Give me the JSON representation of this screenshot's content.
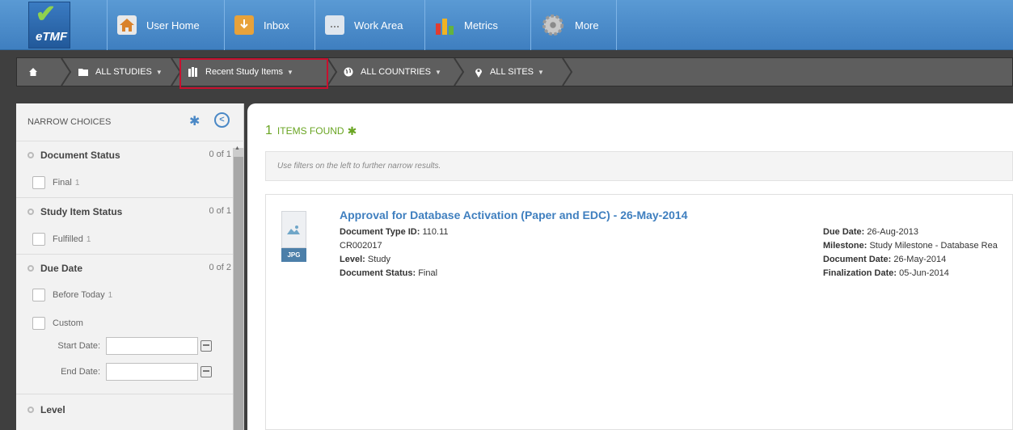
{
  "app": {
    "logo_text": "eTMF"
  },
  "topnav": {
    "items": [
      {
        "label": "User Home",
        "icon": "home-icon"
      },
      {
        "label": "Inbox",
        "icon": "inbox-icon"
      },
      {
        "label": "Work Area",
        "icon": "document-icon"
      },
      {
        "label": "Metrics",
        "icon": "bar-chart-icon"
      },
      {
        "label": "More",
        "icon": "gear-icon"
      }
    ]
  },
  "breadcrumb": {
    "items": [
      {
        "label": "",
        "icon": "home-icon"
      },
      {
        "label": "ALL STUDIES",
        "icon": "folder-icon"
      },
      {
        "label": "Recent Study Items",
        "icon": "books-icon"
      },
      {
        "label": "ALL COUNTRIES",
        "icon": "globe-icon"
      },
      {
        "label": "ALL SITES",
        "icon": "map-pin-icon"
      }
    ]
  },
  "sidebar": {
    "title": "NARROW CHOICES",
    "sections": [
      {
        "title": "Document Status",
        "count": "0 of 1",
        "options": [
          {
            "label": "Final",
            "count": "1"
          }
        ]
      },
      {
        "title": "Study Item Status",
        "count": "0 of 1",
        "options": [
          {
            "label": "Fulfilled",
            "count": "1"
          }
        ]
      },
      {
        "title": "Due Date",
        "count": "0 of 2",
        "options": [
          {
            "label": "Before Today",
            "count": "1"
          },
          {
            "label": "Custom",
            "count": ""
          }
        ]
      },
      {
        "title": "Level",
        "count": "",
        "options": []
      }
    ],
    "date_filters": {
      "start_label": "Start Date:",
      "end_label": "End Date:",
      "start_value": "",
      "end_value": ""
    }
  },
  "results": {
    "count": "1",
    "found_label": "ITEMS FOUND",
    "hint": "Use filters on the left to further narrow results.",
    "items": [
      {
        "file_type": "JPG",
        "title": "Approval for Database Activation (Paper and EDC) - 26-May-2014",
        "left_meta": [
          {
            "label": "Document Type ID:",
            "value": "110.11"
          },
          {
            "label": "",
            "value": "CR002017"
          },
          {
            "label": "Level:",
            "value": "Study"
          },
          {
            "label": "Document Status:",
            "value": "Final"
          }
        ],
        "right_meta": [
          {
            "label": "Due Date:",
            "value": "26-Aug-2013"
          },
          {
            "label": "Milestone:",
            "value": "Study Milestone - Database Rea"
          },
          {
            "label": "Document Date:",
            "value": "26-May-2014"
          },
          {
            "label": "Finalization Date:",
            "value": "05-Jun-2014"
          }
        ]
      }
    ]
  },
  "colors": {
    "nav_blue": "#4a8bc9",
    "accent_green": "#6aa523",
    "link_blue": "#3f7fbf",
    "highlight_red": "#c8102e"
  }
}
